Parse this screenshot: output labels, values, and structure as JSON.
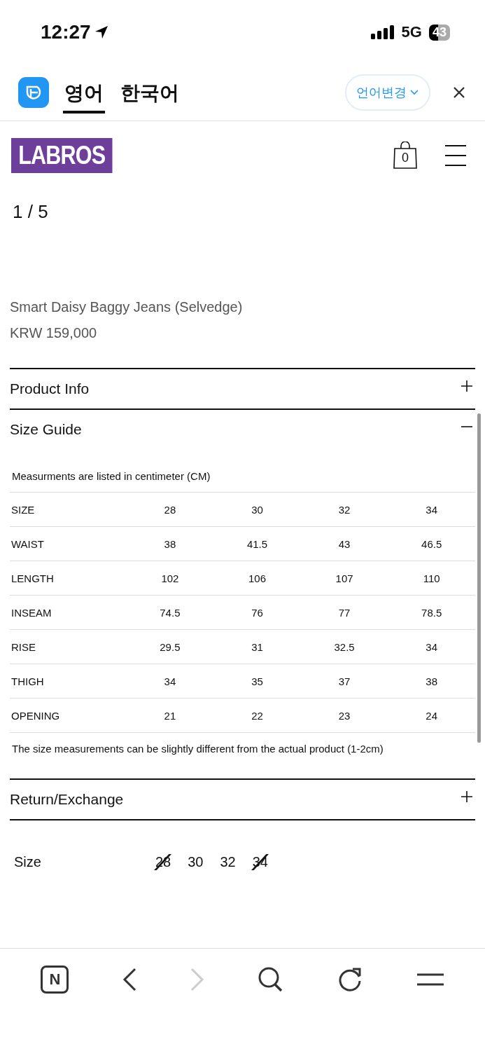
{
  "status_bar": {
    "time": "12:27",
    "network": "5G",
    "battery": "43"
  },
  "translate_bar": {
    "tabs": [
      {
        "label": "영어",
        "selected": true
      },
      {
        "label": "한국어",
        "selected": false
      }
    ],
    "language_button": "언어변경"
  },
  "header": {
    "logo": "LABROS",
    "cart_count": "0"
  },
  "gallery": {
    "counter": "1 / 5"
  },
  "product": {
    "name": "Smart Daisy Baggy Jeans (Selvedge)",
    "price": "KRW 159,000"
  },
  "sections": [
    {
      "title": "Product Info",
      "expanded": false
    },
    {
      "title": "Size Guide",
      "expanded": true,
      "note": "Measurments are listed in centimeter (CM)",
      "table": [
        [
          "SIZE",
          "28",
          "30",
          "32",
          "34"
        ],
        [
          "WAIST",
          "38",
          "41.5",
          "43",
          "46.5"
        ],
        [
          "LENGTH",
          "102",
          "106",
          "107",
          "110"
        ],
        [
          "INSEAM",
          "74.5",
          "76",
          "77",
          "78.5"
        ],
        [
          "RISE",
          "29.5",
          "31",
          "32.5",
          "34"
        ],
        [
          "THIGH",
          "34",
          "35",
          "37",
          "38"
        ],
        [
          "OPENING",
          "21",
          "22",
          "23",
          "24"
        ]
      ],
      "footnote": "The size measurements can be slightly different from the actual product (1-2cm)"
    },
    {
      "title": "Return/Exchange",
      "expanded": false
    }
  ],
  "size_picker": {
    "label": "Size",
    "options": [
      {
        "label": "28",
        "available": false
      },
      {
        "label": "30",
        "available": true
      },
      {
        "label": "32",
        "available": true
      },
      {
        "label": "34",
        "available": false
      }
    ]
  },
  "toolbar": {
    "home_label": "N",
    "back_disabled": false,
    "forward_disabled": true
  }
}
